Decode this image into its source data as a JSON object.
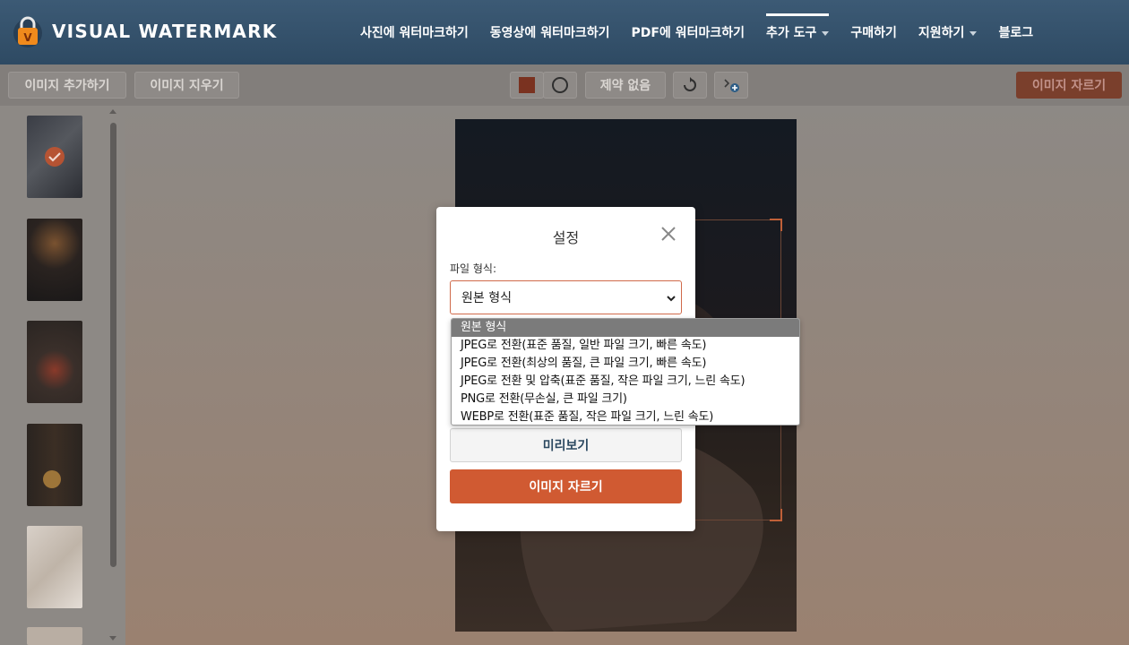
{
  "header": {
    "logo_text": "VISUAL WATERMARK",
    "nav": [
      {
        "label": "사진에 워터마크하기",
        "dropdown": false,
        "active": false
      },
      {
        "label": "동영상에 워터마크하기",
        "dropdown": false,
        "active": false
      },
      {
        "label": "PDF에 워터마크하기",
        "dropdown": false,
        "active": false
      },
      {
        "label": "추가 도구",
        "dropdown": true,
        "active": true
      },
      {
        "label": "구매하기",
        "dropdown": false,
        "active": false
      },
      {
        "label": "지원하기",
        "dropdown": true,
        "active": false
      },
      {
        "label": "블로그",
        "dropdown": false,
        "active": false
      }
    ]
  },
  "toolbar": {
    "add_images": "이미지 추가하기",
    "clear_images": "이미지 지우기",
    "no_constraint": "제약 없음",
    "crop_images": "이미지 자르기"
  },
  "modal": {
    "title": "설정",
    "file_format_label": "파일 형식:",
    "selected_format": "원본 형식",
    "preview_label": "미리보기",
    "crop_label": "이미지 자르기"
  },
  "format_options": [
    "원본 형식",
    "JPEG로 전환(표준 품질, 일반 파일 크기, 빠른 속도)",
    "JPEG로 전환(최상의 품질, 큰 파일 크기, 빠른 속도)",
    "JPEG로 전환 및 압축(표준 품질, 작은 파일 크기, 느린 속도)",
    "PNG로 전환(무손실, 큰 파일 크기)",
    "WEBP로 전환(표준 품질, 작은 파일 크기, 느린 속도)"
  ],
  "colors": {
    "header_bg": "#34506a",
    "accent": "#d05a32",
    "preview_text": "#2b4860"
  }
}
